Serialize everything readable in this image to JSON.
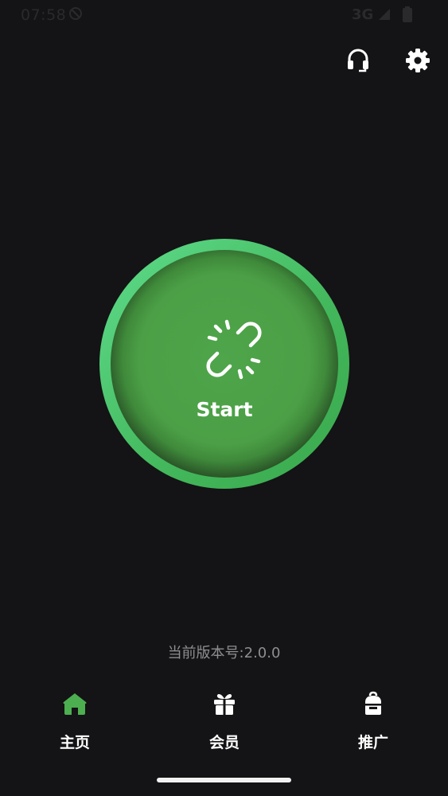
{
  "status_bar": {
    "time": "07:58",
    "network": "3G"
  },
  "main": {
    "connect_button_label": "Start",
    "version_text": "当前版本号:2.0.0"
  },
  "bottom_nav": {
    "items": [
      {
        "label": "主页",
        "icon": "home-icon",
        "active": true
      },
      {
        "label": "会员",
        "icon": "gift-icon",
        "active": false
      },
      {
        "label": "推广",
        "icon": "backpack-icon",
        "active": false
      }
    ]
  },
  "colors": {
    "background": "#141315",
    "accent": "#4caf50",
    "ring": "#5edc8c",
    "muted_text": "#8e8d90"
  }
}
